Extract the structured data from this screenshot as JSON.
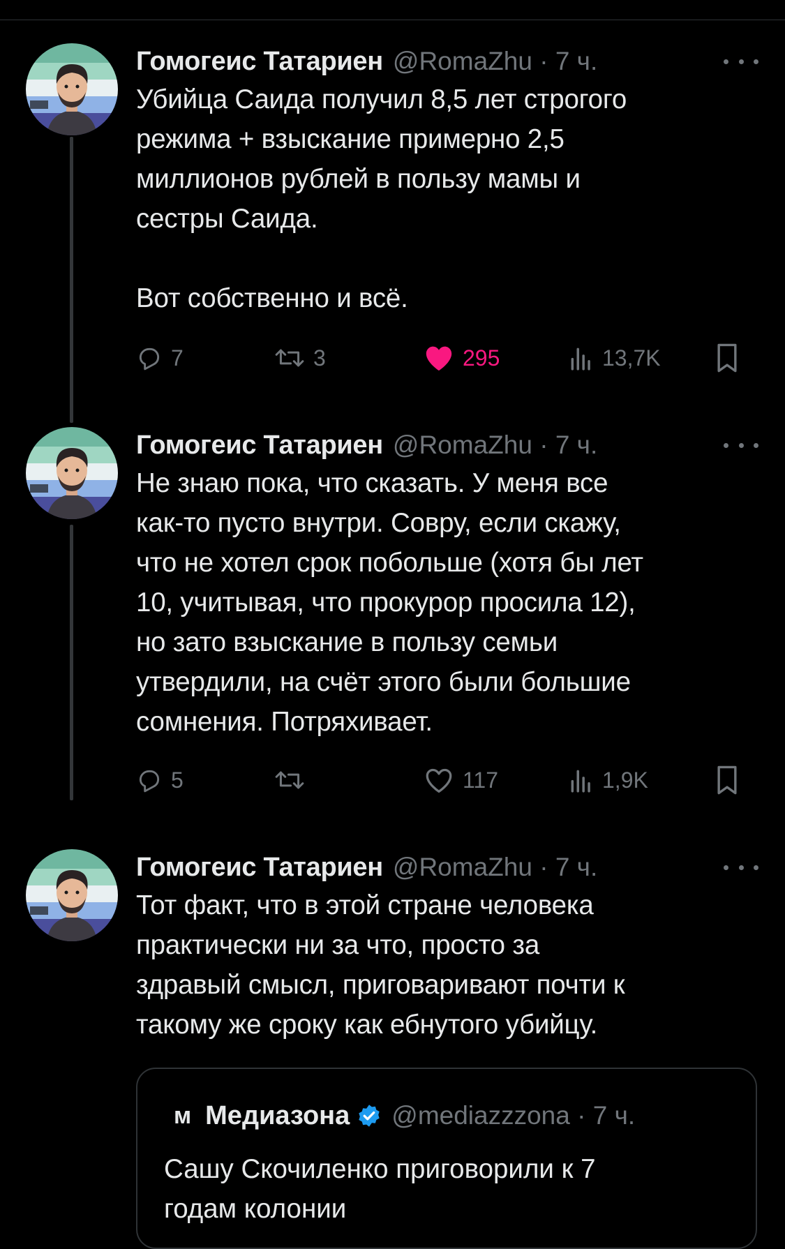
{
  "colors": {
    "background": "#000000",
    "text": "#e7e9ea",
    "muted": "#71767b",
    "like": "#f91880",
    "verified": "#1d9bf0",
    "border": "#2f3336"
  },
  "tweets": [
    {
      "author_name": "Гомогеис Татариен",
      "handle": "@RomaZhu",
      "time": "7 ч.",
      "text": "Убийца Саида получил 8,5 лет строгого\nрежима + взыскание примерно 2,5\nмиллионов рублей в пользу мамы и\nсестры Саида.\n\nВот собственно и всё.",
      "replies": "7",
      "retweets": "3",
      "likes": "295",
      "liked": true,
      "views": "13,7K"
    },
    {
      "author_name": "Гомогеис Татариен",
      "handle": "@RomaZhu",
      "time": "7 ч.",
      "text": "Не знаю пока, что сказать. У меня все\nкак-то пусто внутри. Совру, если скажу,\nчто не хотел срок побольше (хотя бы лет\n10, учитывая, что прокурор просила 12),\nно зато взыскание в пользу семьи\nутвердили, на счёт этого были большие\nсомнения. Потряхивает.",
      "replies": "5",
      "retweets": "",
      "likes": "117",
      "liked": false,
      "views": "1,9K"
    },
    {
      "author_name": "Гомогеис Татариен",
      "handle": "@RomaZhu",
      "time": "7 ч.",
      "text": "Тот факт, что в этой стране человека\nпрактически ни за что, просто за\nздравый смысл, приговаривают почти к\nтакому же сроку как ебнутого убийцу."
    }
  ],
  "quote": {
    "logo": "м",
    "author_name": "Медиазона",
    "handle": "@mediazzzona",
    "time": "7 ч.",
    "text": "Сашу Скочиленко приговорили к 7\nгодам колонии"
  },
  "icons": {
    "reply": "reply-icon",
    "retweet": "retweet-icon",
    "like": "heart-icon",
    "views": "views-icon",
    "bookmark": "bookmark-icon",
    "more": "more-icon",
    "verified": "verified-badge-icon"
  }
}
